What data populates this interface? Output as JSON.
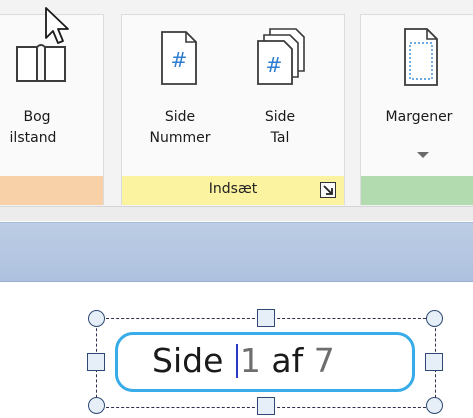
{
  "ribbon": {
    "view_group": {
      "book_button": {
        "label_line1": "Bog",
        "label_line2": "ilstand",
        "icon": "open-book-icon"
      }
    },
    "insert_group": {
      "label": "Indsæt",
      "label_color": "#fbf3a0",
      "dialog_launcher_icon": "dialog-launcher-icon",
      "page_number_button": {
        "label_line1": "Side",
        "label_line2": "Nummer",
        "icon": "page-number-icon"
      },
      "page_count_button": {
        "label_line1": "Side",
        "label_line2": "Tal",
        "icon": "page-count-icon"
      }
    },
    "layout_group": {
      "margins_button": {
        "label": "Margener",
        "icon": "margins-icon",
        "dropdown_icon": "dropdown-arrow-icon"
      },
      "label_color": "#b3dbb0"
    },
    "view_group_label_color": "#f9d1a8"
  },
  "cursor": {
    "icon": "mouse-pointer-icon"
  },
  "document": {
    "page_field": {
      "prefix": "Side ",
      "current_page": "1",
      "separator": " af ",
      "total_pages": "7",
      "border_color": "#38ace8"
    }
  }
}
